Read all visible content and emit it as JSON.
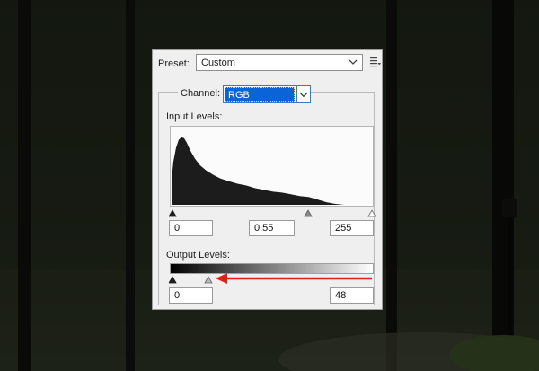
{
  "preset": {
    "label": "Preset:",
    "value": "Custom"
  },
  "channel": {
    "label": "Channel:",
    "value": "RGB"
  },
  "input_levels": {
    "label": "Input Levels:",
    "black": "0",
    "gamma": "0.55",
    "white": "255"
  },
  "output_levels": {
    "label": "Output Levels:",
    "black": "0",
    "white": "48"
  },
  "icons": {
    "preset_dropdown": "chevron-down-icon",
    "preset_options": "panel-menu-icon",
    "channel_dropdown": "chevron-down-icon",
    "annotation": "red-arrow-icon"
  },
  "colors": {
    "channel_highlight": "#0b63d8",
    "annotation_arrow": "#e0201b",
    "histogram_fill": "#1c1c1c"
  }
}
